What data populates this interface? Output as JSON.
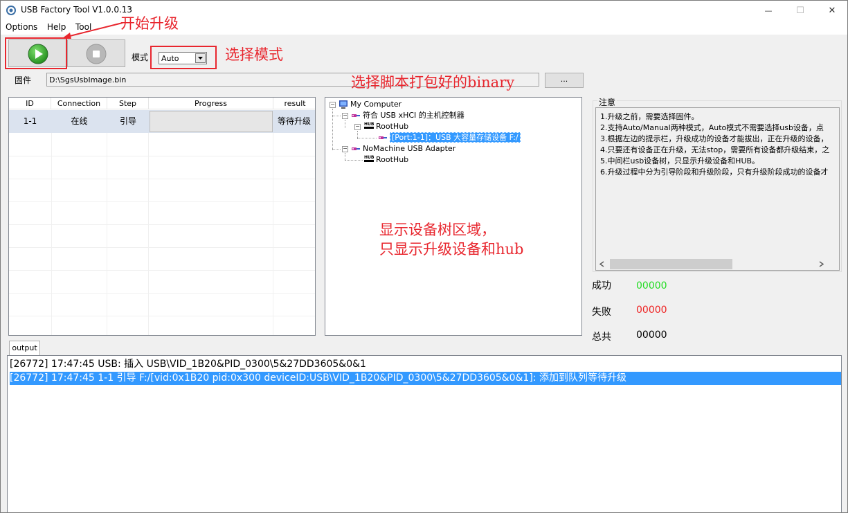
{
  "window": {
    "title": "USB Factory Tool V1.0.0.13",
    "minimize_glyph": "—",
    "maximize_glyph": "☐",
    "close_glyph": "✕"
  },
  "menu": {
    "items": [
      {
        "label": "Options"
      },
      {
        "label": "Help"
      },
      {
        "label": "Tool"
      }
    ]
  },
  "controls": {
    "mode_label": "模式",
    "mode_value": "Auto",
    "firmware_label": "固件",
    "firmware_path": "D:\\SgsUsbImage.bin",
    "browse_label": "..."
  },
  "table": {
    "columns": [
      "ID",
      "Connection",
      "Step",
      "Progress",
      "result"
    ],
    "rows": [
      {
        "id": "1-1",
        "connection": "在线",
        "step": "引导",
        "progress": 0,
        "result": "等待升级"
      }
    ]
  },
  "tree": {
    "nodes": [
      {
        "label": "My Computer"
      },
      {
        "label": "符合 USB xHCI 的主机控制器"
      },
      {
        "label": "RootHub"
      },
      {
        "label": "[Port:1-1]：USB 大容量存储设备  F:/"
      },
      {
        "label": "NoMachine USB Adapter"
      },
      {
        "label": "RootHub"
      }
    ],
    "hub_icon_text": "HUB"
  },
  "notes": {
    "title": "注意",
    "lines": [
      "1.升级之前，需要选择固件。",
      "2.支持Auto/Manual两种模式，Auto模式不需要选择usb设备，点",
      "3.根据左边的提示栏，升级成功的设备才能拔出，正在升级的设备，",
      "4.只要还有设备正在升级，无法stop，需要所有设备都升级结束，之",
      "5.中间栏usb设备树，只显示升级设备和HUB。",
      "6.升级过程中分为引导阶段和升级阶段，只有升级阶段成功的设备才"
    ]
  },
  "stats": {
    "success_label": "成功",
    "success_value": "00000",
    "fail_label": "失败",
    "fail_value": "00000",
    "total_label": "总共",
    "total_value": "00000",
    "success_color": "#22dd22",
    "fail_color": "#ee2222"
  },
  "output": {
    "tab_label": "output",
    "lines": [
      "[26772] 17:47:45  USB: 插入 USB\\VID_1B20&PID_0300\\5&27DD3605&0&1",
      "[26772] 17:47:45  1-1  引导 F:/[vid:0x1B20  pid:0x300 deviceID:USB\\VID_1B20&PID_0300\\5&27DD3605&0&1]: 添加到队列等待升级"
    ]
  },
  "annotations": {
    "start_upgrade": "开始升级",
    "select_mode": "选择模式",
    "select_binary": "选择脚本打包好的binary",
    "tree_area_line1": "显示设备树区域，",
    "tree_area_line2": "只显示升级设备和hub",
    "color": "#e8262e"
  }
}
